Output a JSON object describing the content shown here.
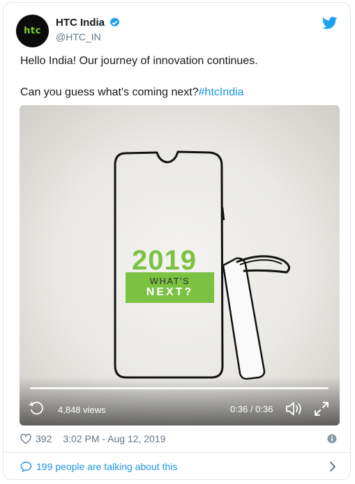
{
  "account": {
    "avatar_text": "htc",
    "display_name": "HTC India",
    "handle": "@HTC_IN",
    "verified": true
  },
  "tweet": {
    "line1": "Hello India! Our journey of innovation continues.",
    "line2_text": "Can you guess what's coming next?",
    "hashtag": "#htcIndia"
  },
  "media": {
    "year": "2019",
    "whats": "WHAT'S",
    "next": "NEXT?",
    "views": "4,848 views",
    "time": "0:36 / 0:36",
    "progress_fraction": 1.0
  },
  "meta": {
    "likes": "392",
    "timestamp": "3:02 PM - Aug 12, 2019"
  },
  "footer": {
    "conversation": "199 people are talking about this"
  },
  "colors": {
    "link": "#1b95e0",
    "verified": "#1da1f2",
    "brand_green": "#7cc242",
    "muted": "#657786"
  },
  "icons": [
    "htc-logo",
    "verified-icon",
    "twitter-bird-icon",
    "replay-icon",
    "volume-icon",
    "expand-icon",
    "heart-icon",
    "info-icon",
    "comment-bubble-icon",
    "chevron-right-icon"
  ]
}
